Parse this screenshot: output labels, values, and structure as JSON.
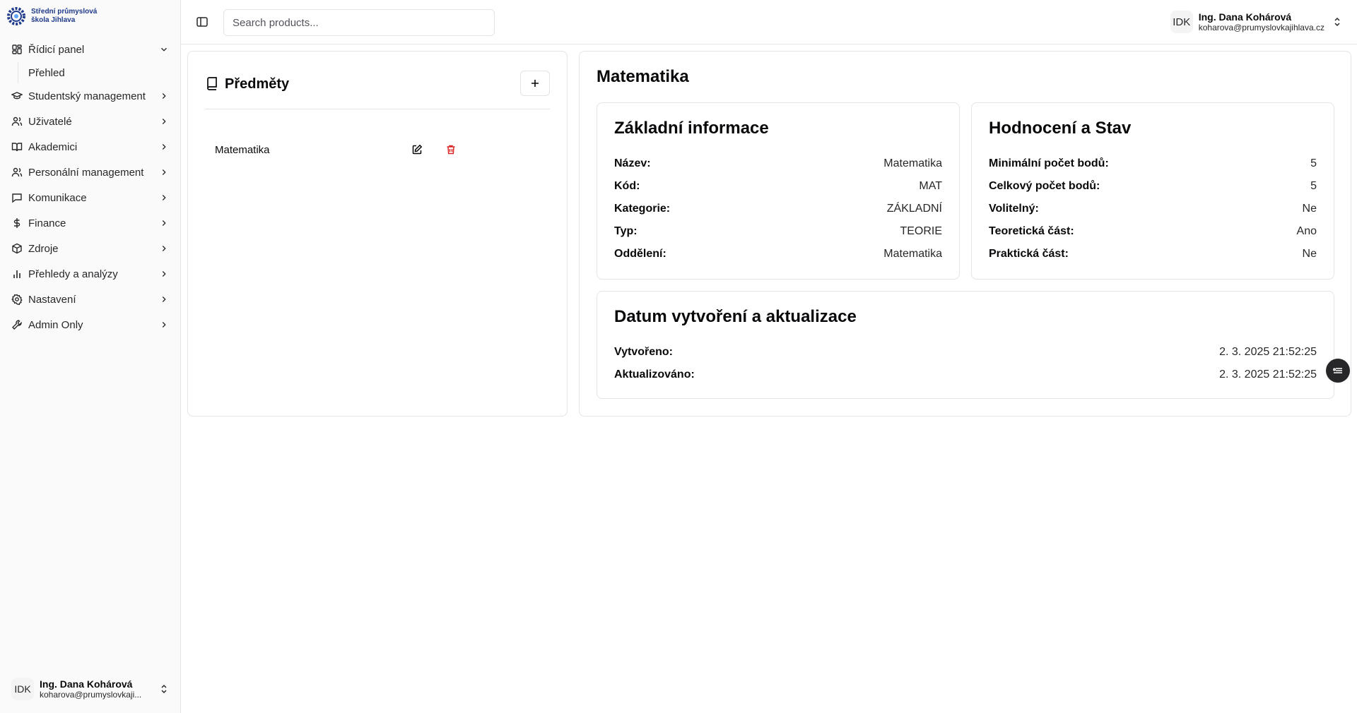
{
  "brand": {
    "line1": "Střední průmyslová",
    "line2": "škola Jihlava"
  },
  "nav": {
    "items": [
      {
        "label": "Řídicí panel",
        "icon": "dashboard-icon"
      },
      {
        "label": "Studentský management",
        "icon": "graduation-cap-icon"
      },
      {
        "label": "Uživatelé",
        "icon": "users-icon"
      },
      {
        "label": "Akademici",
        "icon": "book-open-icon"
      },
      {
        "label": "Personální management",
        "icon": "user-group-icon"
      },
      {
        "label": "Komunikace",
        "icon": "message-icon"
      },
      {
        "label": "Finance",
        "icon": "dollar-icon"
      },
      {
        "label": "Zdroje",
        "icon": "package-icon"
      },
      {
        "label": "Přehledy a analýzy",
        "icon": "bar-chart-icon"
      },
      {
        "label": "Nastavení",
        "icon": "gear-icon"
      },
      {
        "label": "Admin Only",
        "icon": "wrench-icon"
      }
    ],
    "sub_overview": "Přehled"
  },
  "user": {
    "initials": "IDK",
    "name": "Ing. Dana Kohárová",
    "email": "koharova@prumyslovkajihlava.cz",
    "email_truncated": "koharova@prumyslovkaji..."
  },
  "search": {
    "placeholder": "Search products..."
  },
  "subjects_panel": {
    "title": "Předměty",
    "items": [
      {
        "name": "Matematika"
      }
    ]
  },
  "detail": {
    "title": "Matematika",
    "basic": {
      "title": "Základní informace",
      "rows": [
        {
          "k": "Název:",
          "v": "Matematika"
        },
        {
          "k": "Kód:",
          "v": "MAT"
        },
        {
          "k": "Kategorie:",
          "v": "ZÁKLADNÍ"
        },
        {
          "k": "Typ:",
          "v": "TEORIE"
        },
        {
          "k": "Oddělení:",
          "v": "Matematika"
        }
      ]
    },
    "grading": {
      "title": "Hodnocení a Stav",
      "rows": [
        {
          "k": "Minimální počet bodů:",
          "v": "5"
        },
        {
          "k": "Celkový počet bodů:",
          "v": "5"
        },
        {
          "k": "Volitelný:",
          "v": "Ne"
        },
        {
          "k": "Teoretická část:",
          "v": "Ano"
        },
        {
          "k": "Praktická část:",
          "v": "Ne"
        }
      ]
    },
    "dates": {
      "title": "Datum vytvoření a aktualizace",
      "rows": [
        {
          "k": "Vytvořeno:",
          "v": "2. 3. 2025 21:52:25"
        },
        {
          "k": "Aktualizováno:",
          "v": "2. 3. 2025 21:52:25"
        }
      ]
    }
  },
  "colors": {
    "accent": "#1e3a8a",
    "danger": "#dc2626",
    "border": "#e4e4e7"
  }
}
